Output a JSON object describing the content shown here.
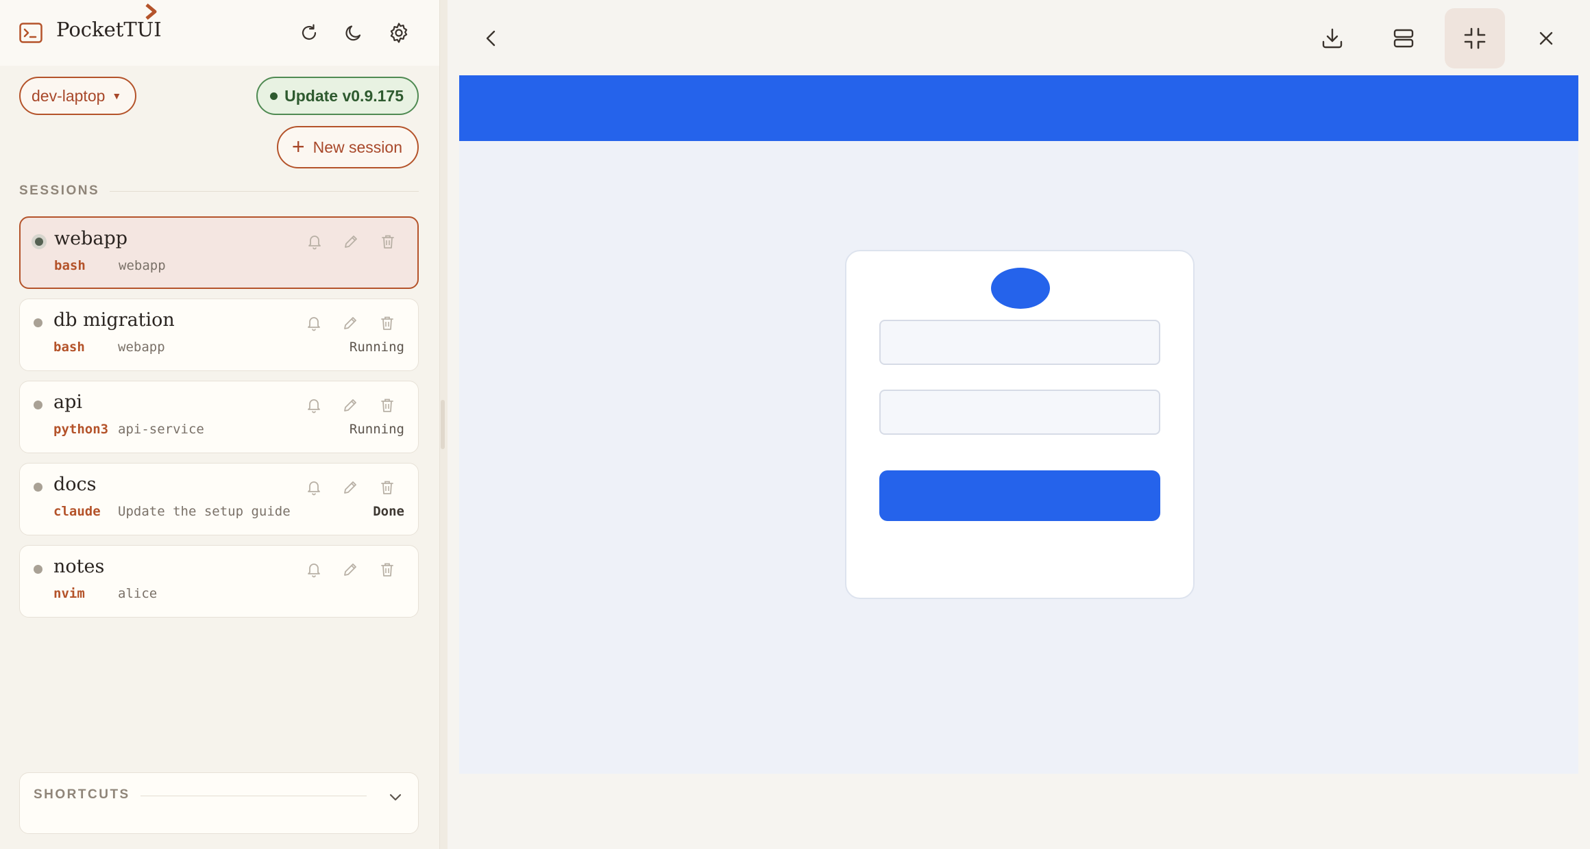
{
  "app": {
    "title": "PocketTUI"
  },
  "header": {
    "refresh_icon": "refresh-icon",
    "theme_icon": "moon-icon",
    "settings_icon": "gear-icon"
  },
  "host": {
    "selected": "dev-laptop",
    "caret": "▼"
  },
  "update": {
    "label": "Update v0.9.175"
  },
  "new_session": {
    "plus": "+",
    "label": "New session"
  },
  "sessions_label": "SESSIONS",
  "sessions": [
    {
      "name": "webapp",
      "cmd": "bash",
      "dir": "webapp",
      "state": "",
      "active": true
    },
    {
      "name": "db migration",
      "cmd": "bash",
      "dir": "webapp",
      "state": "Running",
      "active": false
    },
    {
      "name": "api",
      "cmd": "python3",
      "dir": "api-service",
      "state": "Running",
      "active": false
    },
    {
      "name": "docs",
      "cmd": "claude",
      "dir": "Update the setup guide",
      "state": "Done",
      "active": false
    },
    {
      "name": "notes",
      "cmd": "nvim",
      "dir": "alice",
      "state": "",
      "active": false
    }
  ],
  "shortcuts": {
    "label": "SHORTCUTS"
  },
  "colors": {
    "accent": "#b4532a",
    "update_green": "#4f8a52",
    "preview_blue": "#2563eb"
  },
  "preview_toolbar": {
    "back_icon": "chevron-left-icon",
    "download_icon": "download-icon",
    "layout_icon": "layout-rows-icon",
    "minimize_icon": "minimize-icon",
    "close_icon": "close-icon"
  }
}
